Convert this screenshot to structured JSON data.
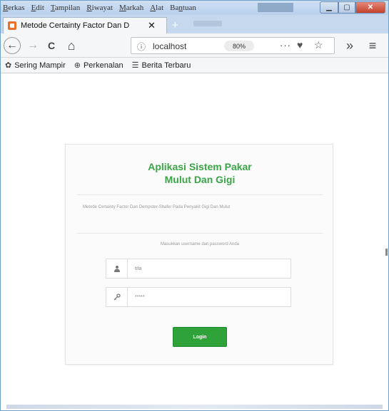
{
  "window": {
    "menu": [
      {
        "pre": "",
        "ul": "B",
        "post": "erkas"
      },
      {
        "pre": "",
        "ul": "E",
        "post": "dit"
      },
      {
        "pre": "",
        "ul": "T",
        "post": "ampilan"
      },
      {
        "pre": "",
        "ul": "R",
        "post": "iwayat"
      },
      {
        "pre": "",
        "ul": "M",
        "post": "arkah"
      },
      {
        "pre": "",
        "ul": "A",
        "post": "lat"
      },
      {
        "pre": "Ba",
        "ul": "n",
        "post": "tuan"
      }
    ],
    "controls": {
      "minimize_icon": "minimize-icon",
      "maximize_icon": "maximize-icon",
      "close_icon": "close-icon",
      "close_glyph": "✕"
    }
  },
  "tab": {
    "title": "Metode Certainty Factor Dan D",
    "close_glyph": "✕",
    "new_tab_glyph": "+"
  },
  "nav": {
    "back_glyph": "←",
    "forward_glyph": "→",
    "reload_glyph": "C",
    "home_glyph": "⌂",
    "info_glyph": "ⓘ",
    "url": "localhost",
    "zoom": "80%",
    "more_glyph": "···",
    "pocket_glyph": "♥",
    "star_glyph": "☆",
    "overflow_glyph": "»",
    "menu_glyph": "≡"
  },
  "bookmarks": [
    {
      "icon": "gear-icon",
      "glyph": "✿",
      "label": "Sering Mampir"
    },
    {
      "icon": "globe-icon",
      "glyph": "⊕",
      "label": "Perkenalan"
    },
    {
      "icon": "rss-icon",
      "glyph": "☰",
      "label": "Berita Terbaru"
    }
  ],
  "login": {
    "title_line1": "Aplikasi Sistem Pakar",
    "title_line2": "Mulut Dan Gigi",
    "description": "Metode Certainty Factor Dan Dempster-Shafer Pada Penyakit Gigi Dan Mulut",
    "hint": "Masukkan username dan password Anda",
    "username_value": "tifa",
    "password_value": "*****",
    "login_label": "Login",
    "accent_color": "#3aa546"
  }
}
